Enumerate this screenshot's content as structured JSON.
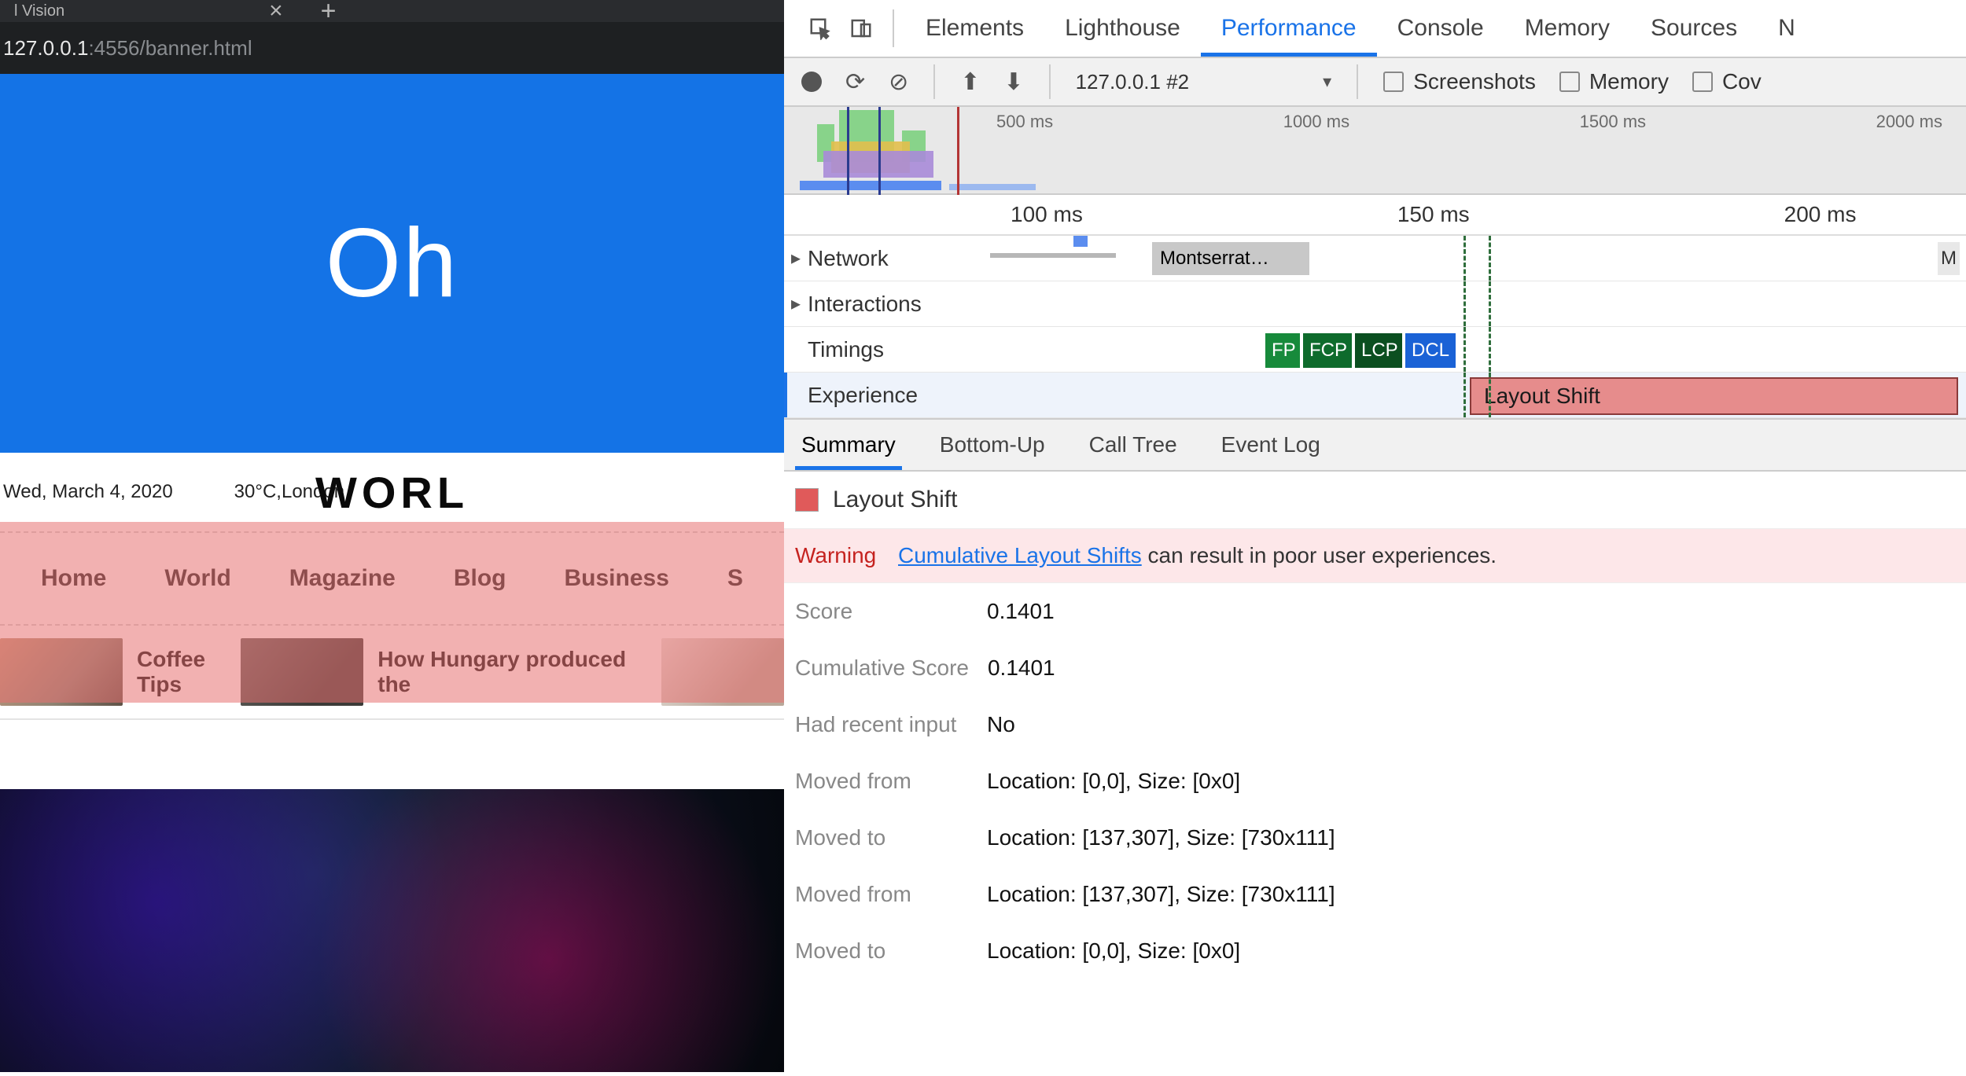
{
  "browser": {
    "tab_title": "l Vision",
    "url_host": "127.0.0.1",
    "url_path": ":4556/banner.html"
  },
  "page": {
    "banner_text": "Oh",
    "date": "Wed, March 4, 2020",
    "weather": "30°C,London",
    "site_title": "WORL",
    "nav": [
      "Home",
      "World",
      "Magazine",
      "Blog",
      "Business",
      "S"
    ],
    "ticker": [
      {
        "title": "Coffee Tips"
      },
      {
        "title": "How Hungary produced the"
      }
    ]
  },
  "devtools": {
    "panels": [
      "Elements",
      "Lighthouse",
      "Performance",
      "Console",
      "Memory",
      "Sources",
      "N"
    ],
    "active_panel": "Performance",
    "toolbar": {
      "recording_label": "127.0.0.1 #2",
      "checks": [
        "Screenshots",
        "Memory",
        "Cov"
      ]
    },
    "overview_ticks": [
      "500 ms",
      "1000 ms",
      "1500 ms",
      "2000 ms"
    ],
    "ruler_ticks": [
      "100 ms",
      "150 ms",
      "200 ms"
    ],
    "tracks": {
      "network": "Network",
      "network_item": "Montserrat…",
      "network_tail": "M",
      "interactions": "Interactions",
      "timings": "Timings",
      "experience": "Experience"
    },
    "timing_markers": {
      "fp": "FP",
      "fcp": "FCP",
      "lcp": "LCP",
      "dcl": "DCL"
    },
    "experience_block": "Layout Shift",
    "bottom_tabs": [
      "Summary",
      "Bottom-Up",
      "Call Tree",
      "Event Log"
    ],
    "active_bottom_tab": "Summary",
    "summary": {
      "title": "Layout Shift",
      "warning_label": "Warning",
      "warning_link": "Cumulative Layout Shifts",
      "warning_rest": " can result in poor user experiences.",
      "rows": [
        {
          "k": "Score",
          "v": "0.1401"
        },
        {
          "k": "Cumulative Score",
          "v": "0.1401"
        },
        {
          "k": "Had recent input",
          "v": "No"
        },
        {
          "k": "Moved from",
          "v": "Location: [0,0], Size: [0x0]"
        },
        {
          "k": "Moved to",
          "v": "Location: [137,307], Size: [730x111]"
        },
        {
          "k": "Moved from",
          "v": "Location: [137,307], Size: [730x111]"
        },
        {
          "k": "Moved to",
          "v": "Location: [0,0], Size: [0x0]"
        }
      ]
    }
  }
}
